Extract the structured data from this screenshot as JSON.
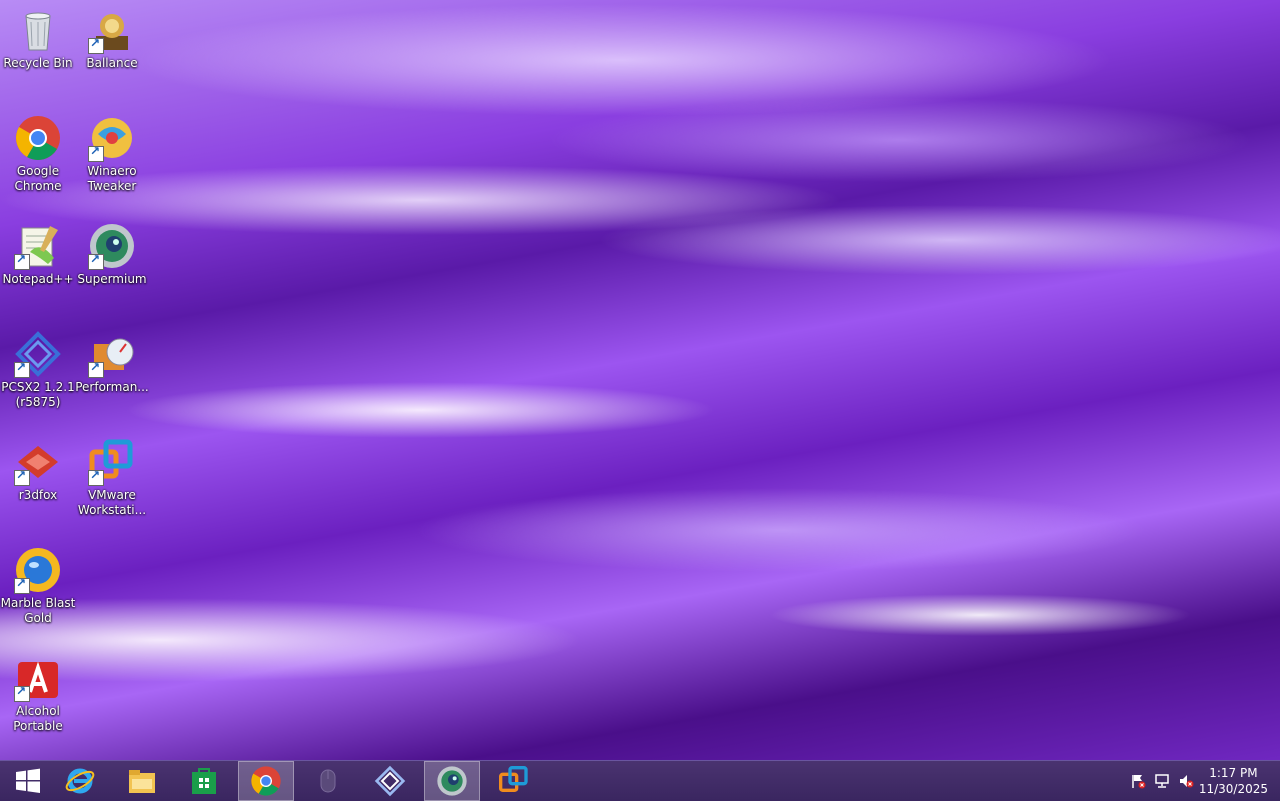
{
  "desktop": {
    "icons": [
      {
        "label": "Recycle Bin"
      },
      {
        "label": "Ballance"
      },
      {
        "label": "Google Chrome"
      },
      {
        "label": "Winaero Tweaker"
      },
      {
        "label": "Notepad++"
      },
      {
        "label": "Supermium"
      },
      {
        "label": "PCSX2 1.2.1 (r5875)"
      },
      {
        "label": "Performan..."
      },
      {
        "label": "r3dfox"
      },
      {
        "label": "VMware Workstati..."
      },
      {
        "label": "Marble Blast Gold"
      },
      {
        "label": "Alcohol Portable"
      }
    ]
  },
  "taskbar": {
    "items": [
      "start-icon",
      "internet-explorer-icon",
      "file-explorer-icon",
      "store-icon",
      "chrome-icon",
      "mouse-icon",
      "pcsx2-icon",
      "supermium-icon",
      "vmware-icon"
    ],
    "tray": {
      "icons": [
        "action-center-flag-icon",
        "network-icon",
        "volume-muted-icon"
      ]
    },
    "clock": {
      "time": "1:17 PM",
      "date": "11/30/2025"
    }
  }
}
